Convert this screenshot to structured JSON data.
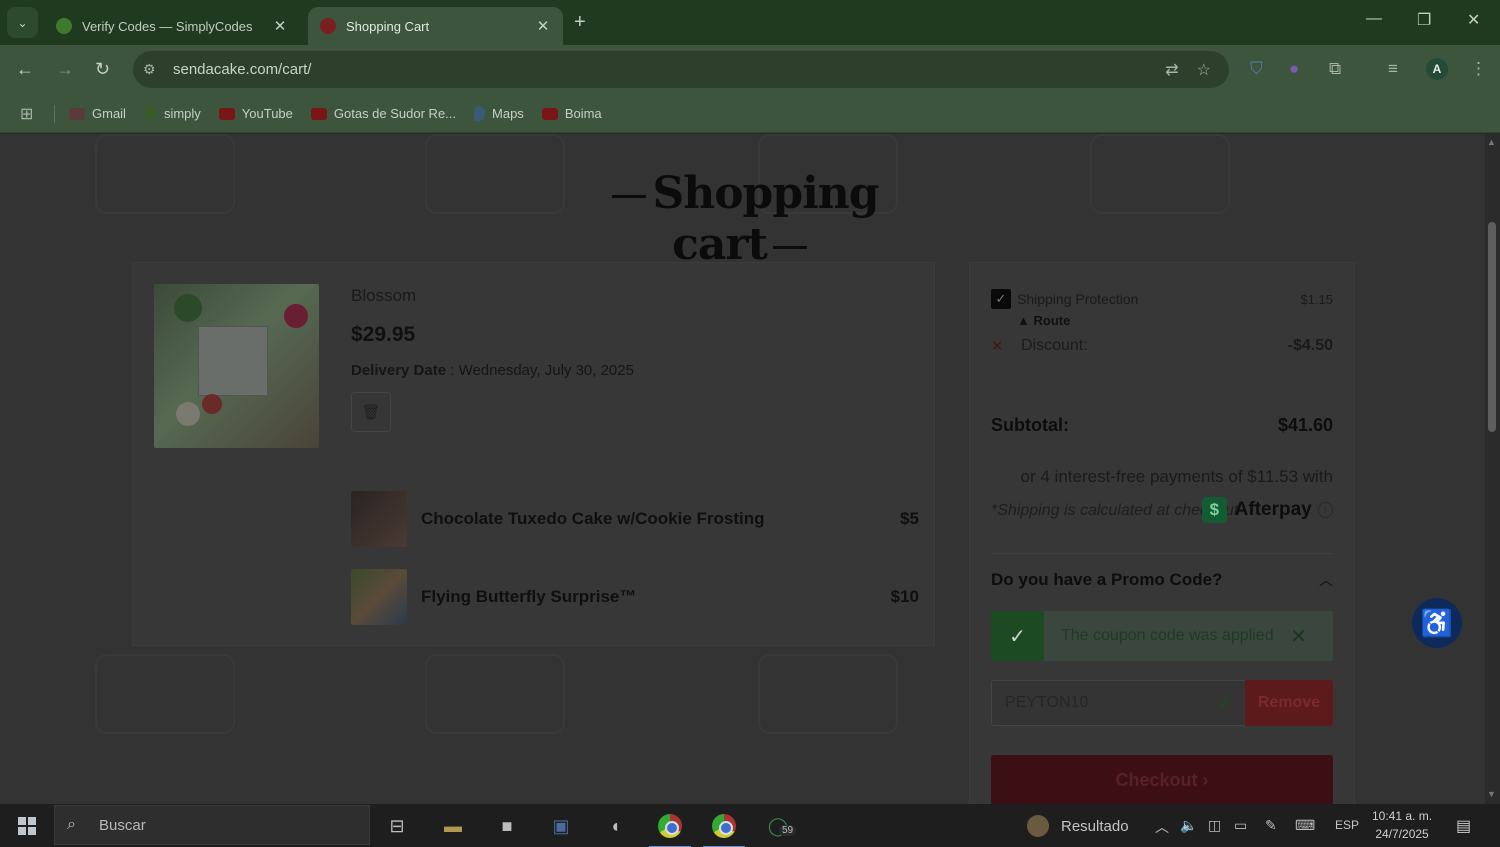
{
  "browser": {
    "tabs": [
      {
        "title": "Verify Codes — SimplyCodes",
        "favicon": "simplycodes-icon",
        "active": false
      },
      {
        "title": "Shopping Cart",
        "favicon": "sendacake-icon",
        "active": true
      }
    ],
    "address": "sendacake.com/cart/",
    "profile_initial": "A",
    "bookmarks": [
      {
        "label": "Gmail",
        "color": "#5a3a3a"
      },
      {
        "label": "simply",
        "color": "#3a5a2a"
      },
      {
        "label": "YouTube",
        "color": "#7a1515"
      },
      {
        "label": "Gotas de Sudor Re...",
        "color": "#7a1515"
      },
      {
        "label": "Maps",
        "color": "#3a5a7a"
      },
      {
        "label": "Boima",
        "color": "#7a1515"
      }
    ]
  },
  "page": {
    "title": "Shopping cart",
    "product": {
      "name": "Blossom",
      "price": "$29.95",
      "delivery_label": "Delivery Date",
      "delivery_value": " : Wednesday, July 30, 2025"
    },
    "addons": [
      {
        "name": "Chocolate Tuxedo Cake w/Cookie Frosting",
        "price": "$5"
      },
      {
        "name": "Flying Butterfly Surprise™",
        "price": "$10"
      }
    ],
    "summary": {
      "shipping_protection_label": "Shipping Protection",
      "shipping_protection_amount": "$1.15",
      "route_label": "Route",
      "discount_label": "Discount:",
      "discount_amount": "-$4.50",
      "shipping_note": "*Shipping is calculated at checkout",
      "subtotal_label": "Subtotal:",
      "subtotal_value": "$41.60",
      "afterpay_text": "or 4 interest-free payments of $11.53 with",
      "afterpay_brand": "Afterpay",
      "promo_question": "Do you have a Promo Code?",
      "coupon_applied_text": "The coupon code was applied",
      "promo_code_value": "PEYTON10",
      "remove_label": "Remove",
      "checkout_label": "Checkout"
    }
  },
  "taskbar": {
    "search_placeholder": "Buscar",
    "weather_label": "Resultado",
    "language": "ESP",
    "time": "10:41 a. m.",
    "date": "24/7/2025",
    "whatsapp_badge": "59"
  }
}
